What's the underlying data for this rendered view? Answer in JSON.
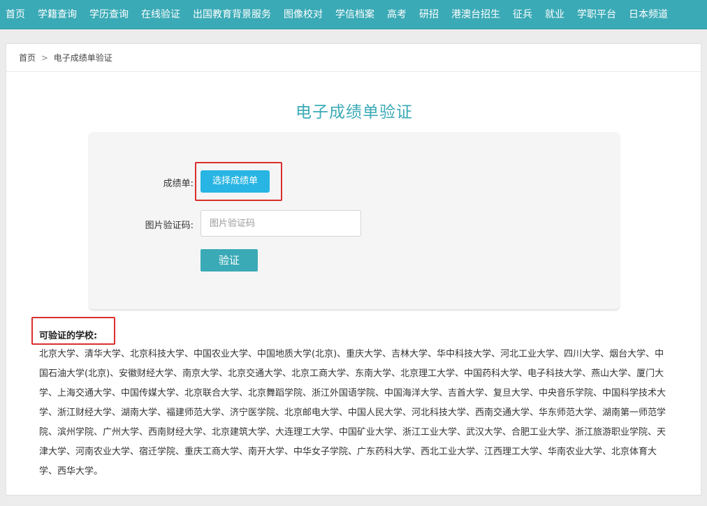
{
  "nav": {
    "items": [
      "首页",
      "学籍查询",
      "学历查询",
      "在线验证",
      "出国教育背景服务",
      "图像校对",
      "学信档案",
      "高考",
      "研招",
      "港澳台招生",
      "征兵",
      "就业",
      "学职平台",
      "日本频道"
    ]
  },
  "breadcrumb": {
    "home": "首页",
    "separator": ">",
    "current": "电子成绩单验证"
  },
  "page": {
    "title": "电子成绩单验证"
  },
  "form": {
    "transcript_label": "成绩单:",
    "choose_button": "选择成绩单",
    "captcha_label": "图片验证码:",
    "captcha_placeholder": "图片验证码",
    "captcha_value": "",
    "verify_button": "验证"
  },
  "schools": {
    "heading": "可验证的学校:",
    "list_text": "北京大学、清华大学、北京科技大学、中国农业大学、中国地质大学(北京)、重庆大学、吉林大学、华中科技大学、河北工业大学、四川大学、烟台大学、中国石油大学(北京)、安徽财经大学、南京大学、北京交通大学、北京工商大学、东南大学、北京理工大学、中国药科大学、电子科技大学、燕山大学、厦门大学、上海交通大学、中国传媒大学、北京联合大学、北京舞蹈学院、浙江外国语学院、中国海洋大学、吉首大学、复旦大学、中央音乐学院、中国科学技术大学、浙江财经大学、湖南大学、福建师范大学、济宁医学院、北京邮电大学、中国人民大学、河北科技大学、西南交通大学、华东师范大学、湖南第一师范学院、滨州学院、广州大学、西南财经大学、北京建筑大学、大连理工大学、中国矿业大学、浙江工业大学、武汉大学、合肥工业大学、浙江旅游职业学院、天津大学、河南农业大学、宿迁学院、重庆工商大学、南开大学、中华女子学院、广东药科大学、西北工业大学、江西理工大学、华南农业大学、北京体育大学、西华大学。"
  },
  "colors": {
    "brand_teal": "#3aaab6",
    "choose_button_blue": "#28b5e3",
    "highlight_red": "#d9302c"
  }
}
